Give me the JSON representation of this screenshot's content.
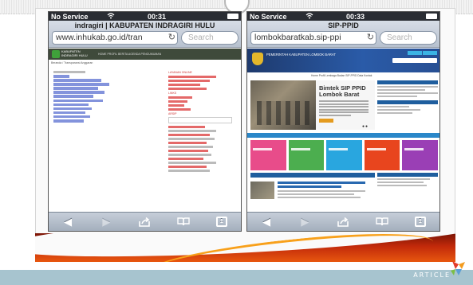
{
  "slide": {
    "footer_label": "ARTICLE"
  },
  "phones": [
    {
      "id": "left",
      "status": {
        "carrier": "No Service",
        "time": "00:31",
        "wifi_icon": "wifi-icon",
        "battery_icon": "battery-icon"
      },
      "page_title": "indragiri | KABUPATEN INDRAGIRI HULU",
      "url": "www.inhukab.go.id/tran",
      "search_placeholder": "Search",
      "site": {
        "name": "KABUPATEN INDRAGIRI HULU",
        "accent_color": "#3fa13a"
      }
    },
    {
      "id": "right",
      "status": {
        "carrier": "No Service",
        "time": "00:33",
        "wifi_icon": "wifi-icon",
        "battery_icon": "battery-icon"
      },
      "page_title": "SIP-PPID",
      "url": "lombokbaratkab.sip-ppi",
      "search_placeholder": "Search",
      "site": {
        "name": "PEMERINTAH KABUPATEN LOMBOK BARAT",
        "headline": "Bimtek SIP PPID Lombok Barat",
        "accent_color": "#2a5ba8"
      }
    }
  ],
  "toolbar_icons": [
    "back-icon",
    "forward-icon",
    "share-icon",
    "bookmarks-icon",
    "tabs-icon"
  ],
  "tabs_count": "1",
  "colors": {
    "swoosh_dark": "#7a1405",
    "swoosh_light": "#e8570f",
    "bottom_bar": "#a7c4cf"
  }
}
